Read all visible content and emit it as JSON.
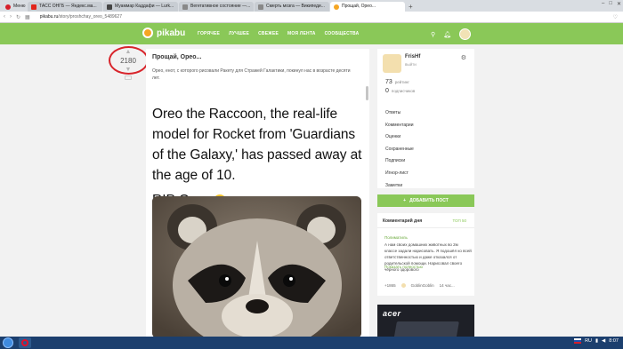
{
  "browser": {
    "tabs": [
      {
        "label": "Меню",
        "color": "#d61f2b"
      },
      {
        "label": "ТАСС ОНГБ — Яндекс.ма...",
        "color": "#e2251b"
      },
      {
        "label": "Муаммар Каддафи — Lurk...",
        "color": "#444444"
      },
      {
        "label": "Вегетативное состояние —...",
        "color": "#555555"
      },
      {
        "label": "Смерть мозга — Википеди...",
        "color": "#555555"
      },
      {
        "label": "Прощай, Орео...",
        "color": "#f5a623"
      }
    ],
    "url_domain": "pikabu.ru",
    "url_path": "/story/proshchay_oreo_5489627"
  },
  "header": {
    "logo": "pikabu",
    "nav": [
      "ГОРЯЧЕЕ",
      "ЛУЧШЕЕ",
      "СВЕЖЕЕ",
      "МОЯ ЛЕНТА",
      "СООБЩЕСТВА"
    ]
  },
  "rating": {
    "value": "2180"
  },
  "post": {
    "title": "Прощай, Орео...",
    "description": "Орео, енот, с которого рисовали Ракету для Стражей Галактики, покинул нас в возрасте десяти лет.",
    "headline": "Oreo the Raccoon, the real-life model for Rocket from 'Guardians of the Galaxy,' has passed away at the age of 10.",
    "rip": "RIP Oreo"
  },
  "profile": {
    "name": "FrisHf",
    "exit": "выйти",
    "rating_value": "73",
    "rating_label": "рейтинг",
    "subs_value": "0",
    "subs_label": "подписчиков",
    "menu": [
      "Ответы",
      "Комментарии",
      "Оценки",
      "Сохраненные",
      "Подписки",
      "Игнор-лист",
      "Заметки"
    ]
  },
  "add_post": {
    "label": "ДОБАВИТЬ ПОСТ"
  },
  "comment_of_day": {
    "title": "Комментарий дня",
    "top_link": "ТОП 50",
    "author": "Полиматиль",
    "text": "А нам своих домашних животных во 2м классе задали нарисовать. Я подошёл ко всей ответственностью и даже отказался от родительской помощи. Нарисовал своего чёрного здорового",
    "more": "Показать полностью",
    "score": "+1865",
    "user": "GoblinGoblin",
    "time": "14 час..."
  },
  "ad": {
    "brand": "acer"
  },
  "taskbar": {
    "lang": "RU",
    "time": "8:07"
  }
}
